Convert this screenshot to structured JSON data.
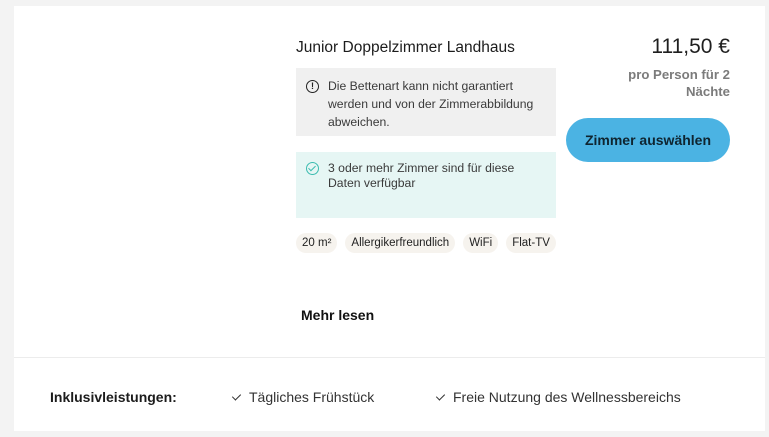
{
  "room": {
    "title": "Junior Doppelzimmer Landhaus",
    "notice": "Die Bettenart kann nicht garantiert werden und von der Zimmerabbildung abweichen.",
    "availability": "3 oder mehr Zimmer sind für diese Daten verfügbar",
    "tags": [
      "20 m²",
      "Allergikerfreundlich",
      "WiFi",
      "Flat-TV"
    ],
    "more_label": "Mehr lesen",
    "notice_icon": "info-icon",
    "availability_icon": "check-circle-icon"
  },
  "pricing": {
    "price": "111,50 €",
    "per_person": "pro Person für 2 Nächte",
    "select_label": "Zimmer auswählen"
  },
  "inclusions": {
    "label": "Inklusivleistungen:",
    "items": [
      "Tägliches Frühstück",
      "Freie Nutzung des Wellnessbereichs"
    ]
  },
  "colors": {
    "accent": "#4bb3e3",
    "availability_bg": "#e6f6f4",
    "notice_bg": "#f0f0f0",
    "check": "#3dbcb0"
  }
}
